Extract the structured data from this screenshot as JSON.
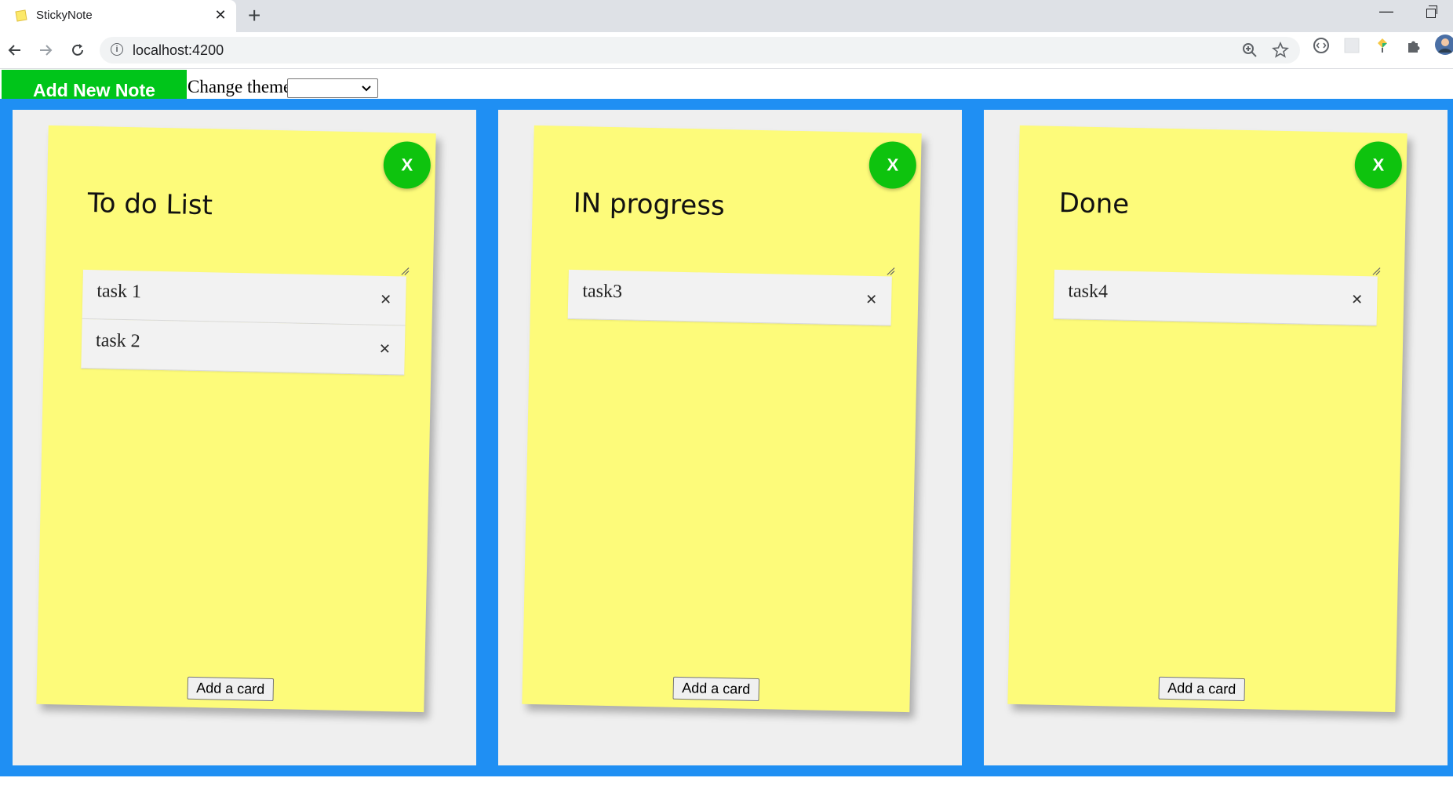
{
  "browser": {
    "tab_title": "StickyNote",
    "url": "localhost:4200"
  },
  "header": {
    "add_note_label": "Add New Note",
    "theme_label": "Change theme",
    "theme_selected": ""
  },
  "colors": {
    "board": "#1f8ff3",
    "note": "#fdfb7a",
    "accent": "#00c51a"
  },
  "notes": [
    {
      "title": "To do List",
      "close_label": "X",
      "add_card_label": "Add a card",
      "cards": [
        "task 1",
        "task 2"
      ]
    },
    {
      "title": "IN progress",
      "close_label": "X",
      "add_card_label": "Add a card",
      "cards": [
        "task3"
      ]
    },
    {
      "title": "Done",
      "close_label": "X",
      "add_card_label": "Add a card",
      "cards": [
        "task4"
      ]
    }
  ]
}
